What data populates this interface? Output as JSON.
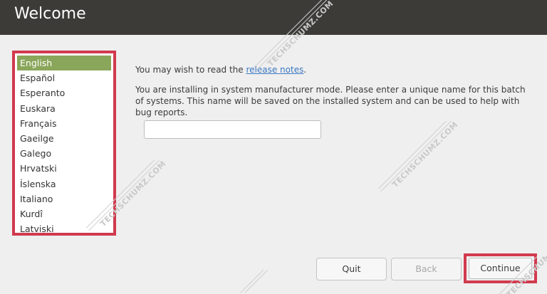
{
  "window": {
    "title": "Welcome"
  },
  "languages": {
    "items": [
      "English",
      "Español",
      "Esperanto",
      "Euskara",
      "Français",
      "Gaeilge",
      "Galego",
      "Hrvatski",
      "Íslenska",
      "Italiano",
      "Kurdî",
      "Latviski"
    ],
    "selected": "English"
  },
  "main": {
    "release_prefix": "You may wish to read the ",
    "release_link": "release notes",
    "release_suffix": ".",
    "oem_message": "You are installing in system manufacturer mode. Please enter a unique name for this batch of systems. This name will be saved on the installed system and can be used to help with bug reports.",
    "batch_name_value": ""
  },
  "buttons": {
    "quit": "Quit",
    "back": "Back",
    "continue": "Continue"
  },
  "watermark": {
    "text": "TECHSCHUMZ.COM"
  },
  "colors": {
    "titlebar": "#3c3b37",
    "selection": "#8aa65a",
    "highlight_box": "#d13a4e",
    "link": "#3b77c3"
  }
}
